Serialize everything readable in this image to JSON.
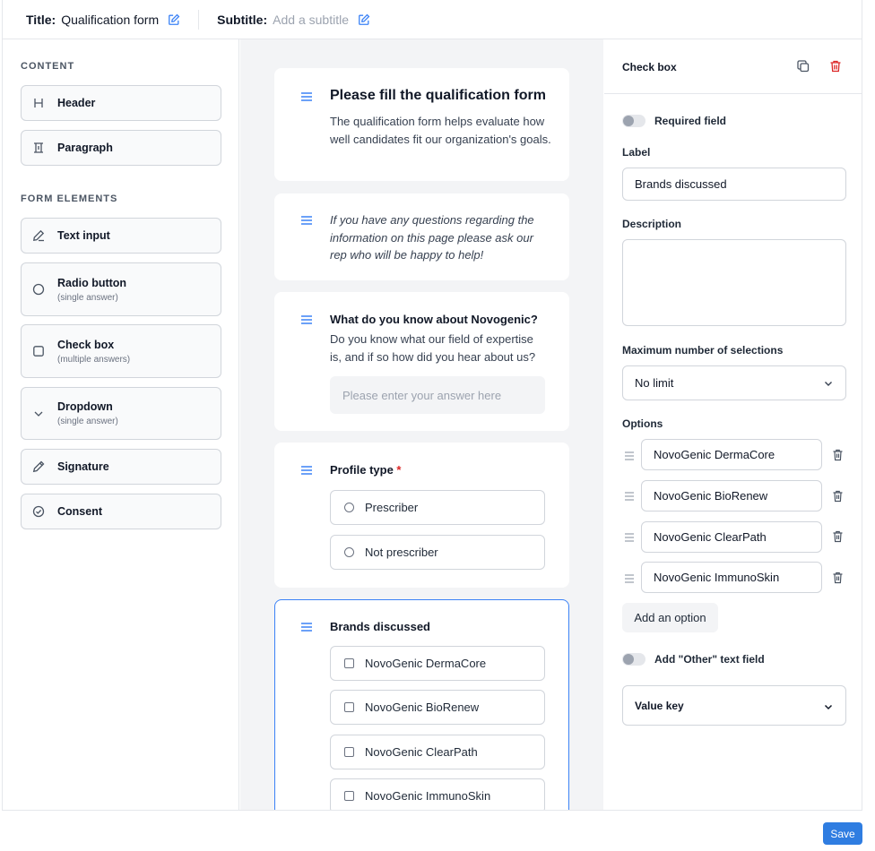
{
  "topbar": {
    "title_label": "Title:",
    "title_value": "Qualification form",
    "subtitle_label": "Subtitle:",
    "subtitle_placeholder": "Add a subtitle"
  },
  "sidebar": {
    "content_heading": "CONTENT",
    "content_items": [
      {
        "label": "Header",
        "icon": "heading-icon"
      },
      {
        "label": "Paragraph",
        "icon": "paragraph-icon"
      }
    ],
    "form_heading": "FORM ELEMENTS",
    "form_items": [
      {
        "label": "Text input",
        "sub": "",
        "icon": "pencil-icon"
      },
      {
        "label": "Radio button",
        "sub": "(single answer)",
        "icon": "radio-icon"
      },
      {
        "label": "Check box",
        "sub": "(multiple answers)",
        "icon": "checkbox-icon"
      },
      {
        "label": "Dropdown",
        "sub": "(single answer)",
        "icon": "chevron-down-icon"
      },
      {
        "label": "Signature",
        "sub": "",
        "icon": "pen-icon"
      },
      {
        "label": "Consent",
        "sub": "",
        "icon": "check-circle-icon"
      }
    ]
  },
  "canvas": {
    "header_card": {
      "title": "Please fill the qualification form",
      "text": "The qualification form helps evaluate how well candidates fit our organization's goals."
    },
    "paragraph_card": {
      "text": "If you have any questions regarding the information on this page please ask our rep who will be happy to help!"
    },
    "text_question": {
      "title": "What do you know about Novogenic?",
      "description": "Do you know what our field of expertise is, and if so how did you hear about us?",
      "placeholder": "Please enter your answer here"
    },
    "radio_question": {
      "title": "Profile type",
      "required_mark": "*",
      "options": [
        "Prescriber",
        "Not prescriber"
      ]
    },
    "checkbox_question": {
      "title": "Brands discussed",
      "options": [
        "NovoGenic DermaCore",
        "NovoGenic BioRenew",
        "NovoGenic ClearPath",
        "NovoGenic ImmunoSkin"
      ]
    }
  },
  "panel": {
    "title": "Check box",
    "required_label": "Required field",
    "label_label": "Label",
    "label_value": "Brands discussed",
    "description_label": "Description",
    "description_value": "",
    "max_label": "Maximum number of selections",
    "max_value": "No limit",
    "options_label": "Options",
    "options": [
      "NovoGenic DermaCore",
      "NovoGenic BioRenew",
      "NovoGenic ClearPath",
      "NovoGenic ImmunoSkin"
    ],
    "add_option": "Add an option",
    "other_label": "Add \"Other\" text field",
    "value_key": "Value key"
  },
  "footer": {
    "save": "Save"
  },
  "colors": {
    "accent": "#2f7de1",
    "selected_border": "#3b82f6",
    "danger": "#dc2626"
  }
}
